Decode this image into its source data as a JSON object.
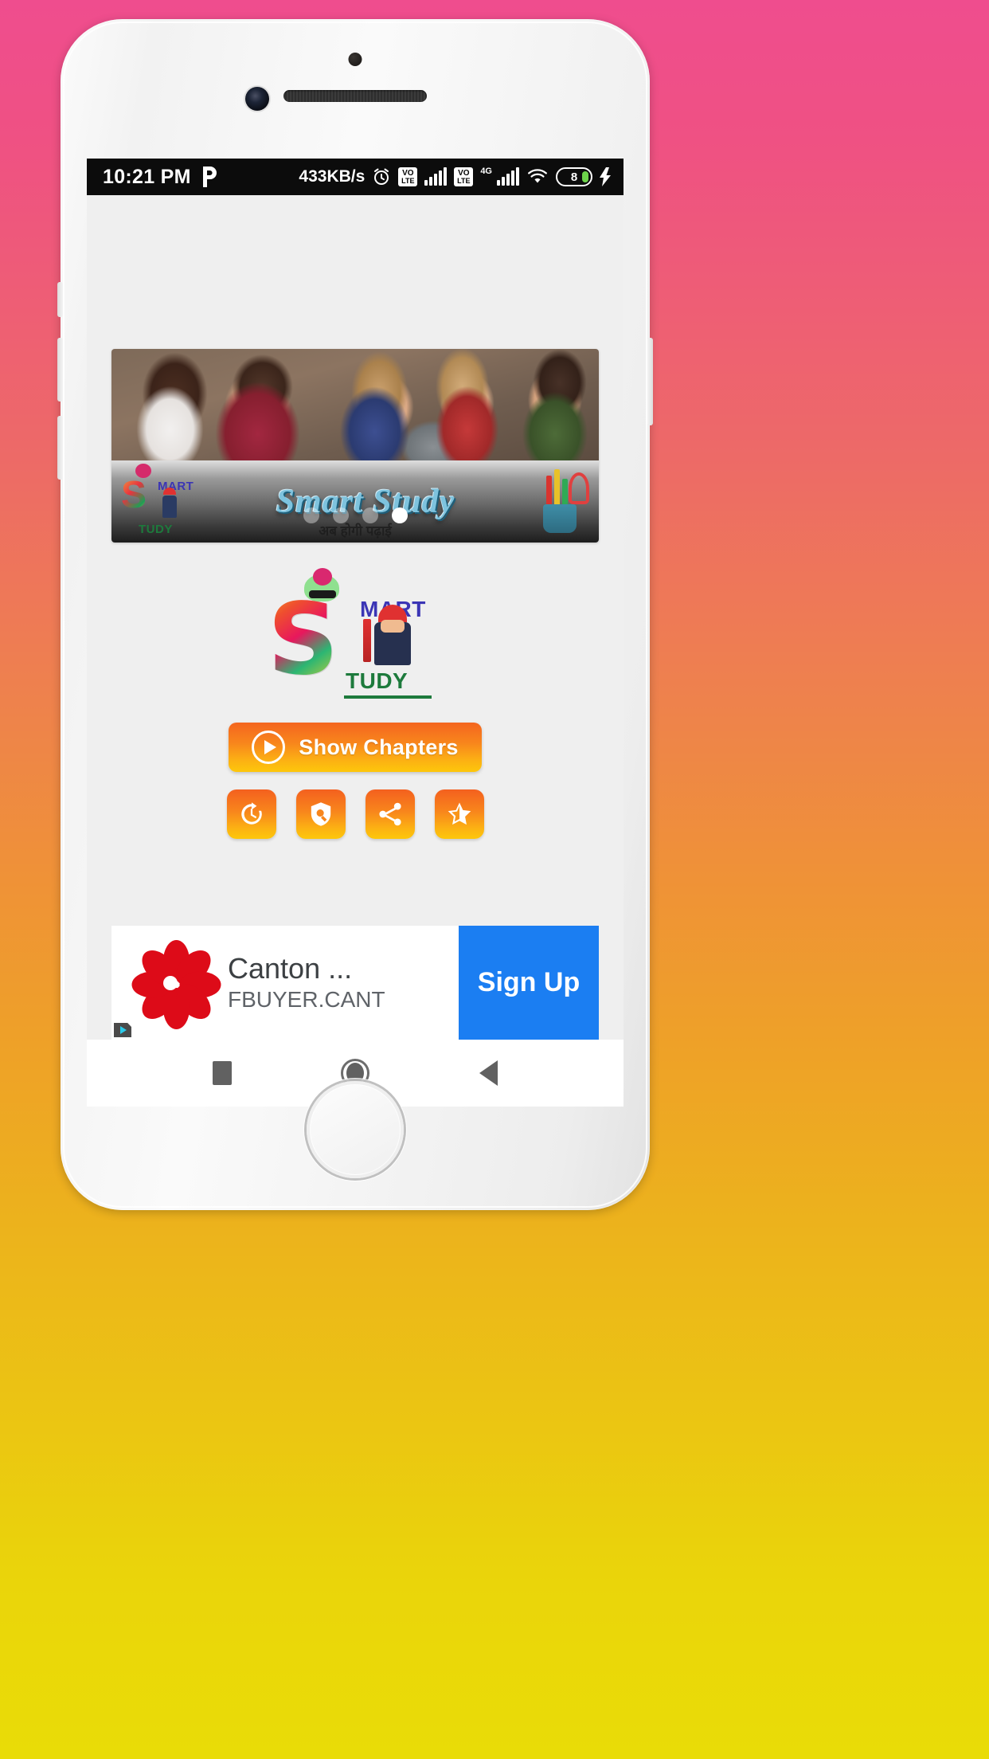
{
  "status_bar": {
    "clock": "10:21 PM",
    "app_badge_icon": "paytm-p-icon",
    "network_speed": "433KB/s",
    "alarm_icon": "alarm-clock-icon",
    "sim1_label_top": "VO",
    "sim1_label_bottom": "LTE",
    "sim2_label_top": "VO",
    "sim2_label_bottom": "LTE",
    "network_generation": "4G",
    "wifi_icon": "wifi-icon",
    "battery_level": "8",
    "charging_icon": "charging-bolt-icon"
  },
  "carousel": {
    "photo_alt": "students-studying-photo",
    "banner_title": "Smart Study",
    "banner_subtitle": "अब होगी पढ़ाई",
    "logo_s": "S",
    "logo_mart": "MART",
    "logo_tudy": "TUDY",
    "dots": [
      {
        "active": false
      },
      {
        "active": false
      },
      {
        "active": false
      },
      {
        "active": true
      }
    ]
  },
  "logo": {
    "letter_s": "S",
    "mart": "MART",
    "tudy": "TUDY"
  },
  "actions": {
    "show_chapters_label": "Show Chapters",
    "play_icon": "play-circle-icon",
    "icon_buttons": [
      {
        "name": "update-button",
        "icon": "refresh-clock-icon"
      },
      {
        "name": "privacy-policy-button",
        "icon": "shield-search-icon"
      },
      {
        "name": "share-button",
        "icon": "share-nodes-icon"
      },
      {
        "name": "rate-button",
        "icon": "half-star-icon"
      }
    ]
  },
  "ad": {
    "headline": "Canton ...",
    "url": "FBUYER.CANT",
    "cta_label": "Sign Up",
    "advertiser_logo": "red-pinwheel-flower-logo",
    "adchoices_icon": "adchoices-icon",
    "cta_color": "#1b7ef2"
  },
  "nav_bar": {
    "recents": "recents-square",
    "home": "home-circle",
    "back": "back-triangle"
  },
  "device": {
    "sensor": "proximity-sensor",
    "camera": "front-camera",
    "earpiece": "earpiece-speaker",
    "home_button": "home-button"
  },
  "theme": {
    "background_top": "#ef4d8e",
    "background_bottom": "#e9dc07",
    "accent_orange": "#f8861c",
    "accent_yellow": "#fdc70b",
    "app_background": "#efefef",
    "status_bar_bg": "#0c0c0c"
  }
}
